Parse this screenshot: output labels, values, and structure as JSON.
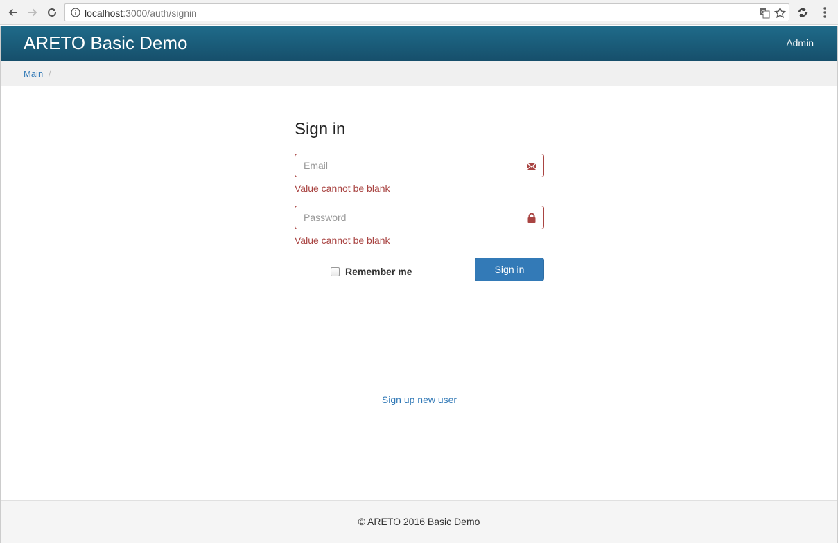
{
  "browser": {
    "url_host": "localhost",
    "url_path": ":3000/auth/signin"
  },
  "navbar": {
    "brand": "ARETO Basic Demo",
    "admin_link": "Admin"
  },
  "breadcrumb": {
    "main": "Main",
    "separator": "/"
  },
  "signin_form": {
    "title": "Sign in",
    "email_placeholder": "Email",
    "email_value": "",
    "email_error": "Value cannot be blank",
    "password_placeholder": "Password",
    "password_value": "",
    "password_error": "Value cannot be blank",
    "remember_label": "Remember me",
    "remember_checked": false,
    "submit_label": "Sign in",
    "signup_link": "Sign up new user"
  },
  "footer": {
    "text": "© ARETO 2016 Basic Demo"
  },
  "colors": {
    "navbar": "#1b5e7d",
    "error": "#a94442",
    "primary": "#337ab7"
  },
  "icons": {
    "email_field": "envelope-icon",
    "password_field": "lock-icon"
  }
}
